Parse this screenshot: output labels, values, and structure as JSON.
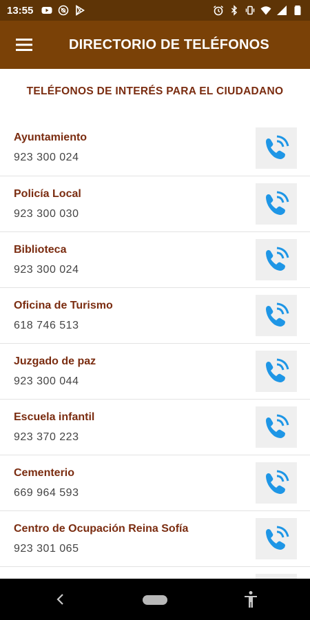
{
  "status_bar": {
    "time": "13:55",
    "left_icons": [
      "youtube-icon",
      "alert-icon",
      "play-store-icon"
    ],
    "right_icons": [
      "alarm-icon",
      "bluetooth-icon",
      "vibrate-icon",
      "wifi-icon",
      "signal-icon",
      "battery-icon"
    ]
  },
  "app_bar": {
    "title": "DIRECTORIO DE TELÉFONOS",
    "menu_icon": "hamburger-menu-icon"
  },
  "section": {
    "heading": "TELÉFONOS DE INTERÉS PARA EL CIUDADANO"
  },
  "contacts": [
    {
      "name": "Ayuntamiento",
      "phone": "923 300 024"
    },
    {
      "name": "Policía Local",
      "phone": "923 300 030"
    },
    {
      "name": "Biblioteca",
      "phone": "923 300 024"
    },
    {
      "name": "Oficina de Turismo",
      "phone": "618 746 513"
    },
    {
      "name": "Juzgado de paz",
      "phone": "923 300 044"
    },
    {
      "name": "Escuela infantil",
      "phone": "923 370 223"
    },
    {
      "name": "Cementerio",
      "phone": "669 964 593"
    },
    {
      "name": "Centro de Ocupación Reina Sofía",
      "phone": "923 301 065"
    },
    {
      "name": "",
      "phone": ""
    }
  ],
  "colors": {
    "status_bar": "#5e3406",
    "app_bar": "#7a4107",
    "accent_text": "#7a2c10",
    "call_icon": "#1e96e6",
    "call_button_bg": "#efefef"
  },
  "nav_bar": {
    "icons": [
      "back-icon",
      "home-pill-icon",
      "accessibility-icon"
    ]
  }
}
